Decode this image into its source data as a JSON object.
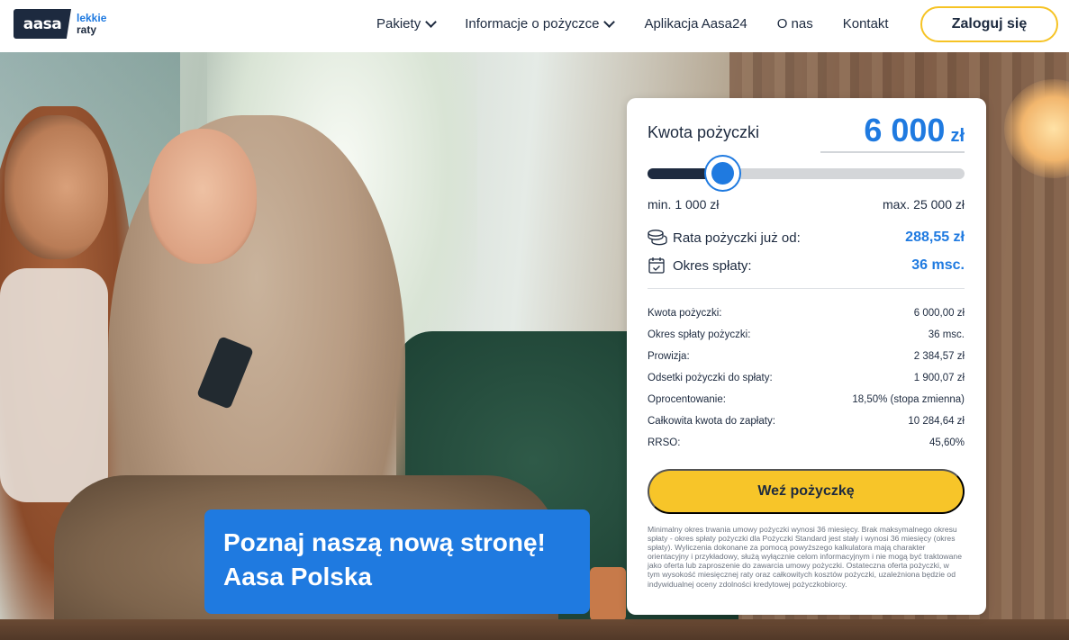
{
  "brand": {
    "logo_text": "aasa",
    "tagline_1": "lekkie",
    "tagline_2": "raty",
    "colors": {
      "navy": "#1d2a3f",
      "blue": "#1f7ae0",
      "yellow": "#f7c529"
    }
  },
  "nav": {
    "items": [
      {
        "label": "Pakiety",
        "has_dropdown": true
      },
      {
        "label": "Informacje o pożyczce",
        "has_dropdown": true
      },
      {
        "label": "Aplikacja Aasa24",
        "has_dropdown": false
      },
      {
        "label": "O nas",
        "has_dropdown": false
      },
      {
        "label": "Kontakt",
        "has_dropdown": false
      }
    ],
    "login_label": "Zaloguj się"
  },
  "promo": {
    "line_1": "Poznaj naszą nową stronę!",
    "line_2": "Aasa Polska"
  },
  "calculator": {
    "amount_label": "Kwota pożyczki",
    "amount_value": "6 000",
    "amount_currency": "zł",
    "slider_fraction": 0.2083,
    "min_label": "min. 1 000 zł",
    "max_label": "max. 25 000 zł",
    "rate_label": "Rata pożyczki już od:",
    "rate_value": "288,55 zł",
    "rate_icon": "coins-icon",
    "term_label": "Okres spłaty:",
    "term_value": "36 msc.",
    "term_icon": "calendar-icon",
    "details": [
      {
        "label": "Kwota pożyczki:",
        "value": "6 000,00 zł"
      },
      {
        "label": "Okres spłaty pożyczki:",
        "value": "36 msc."
      },
      {
        "label": "Prowizja:",
        "value": "2 384,57 zł"
      },
      {
        "label": "Odsetki pożyczki do spłaty:",
        "value": "1 900,07 zł"
      },
      {
        "label": "Oprocentowanie:",
        "value": "18,50% (stopa zmienna)"
      },
      {
        "label": "Całkowita kwota do zapłaty:",
        "value": "10 284,64 zł"
      },
      {
        "label": "RRSO:",
        "value": "45,60%"
      }
    ],
    "cta_label": "Weź pożyczkę",
    "disclaimer": "Minimalny okres trwania umowy pożyczki wynosi 36 miesięcy. Brak maksymalnego okresu spłaty - okres spłaty pożyczki dla Pożyczki Standard jest stały i wynosi 36 miesięcy (okres spłaty). Wyliczenia dokonane za pomocą powyższego kalkulatora mają charakter orientacyjny i przykładowy, służą wyłącznie celom informacyjnym i nie mogą być traktowane jako oferta lub zaproszenie do zawarcia umowy pożyczki. Ostateczna oferta pożyczki, w tym wysokość miesięcznej raty oraz całkowitych kosztów pożyczki, uzależniona będzie od indywidualnej oceny zdolności kredytowej pożyczkobiorcy."
  }
}
